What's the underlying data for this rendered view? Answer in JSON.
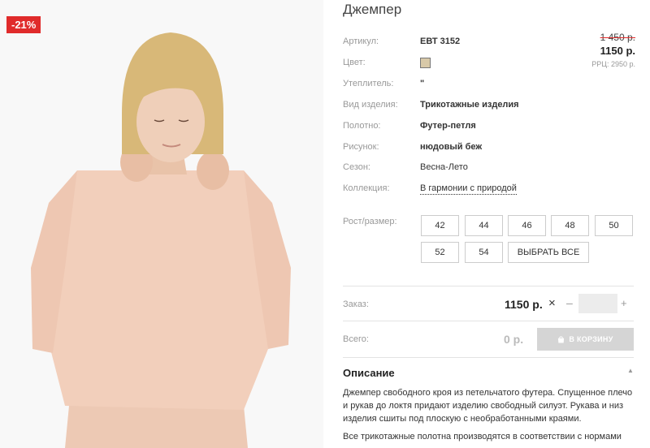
{
  "badge": "-21%",
  "product": {
    "title": "Джемпер",
    "old_price": "1 450 р.",
    "price": "1150 р.",
    "rrp": "РРЦ: 2950 р."
  },
  "attributes": {
    "article_label": "Артикул:",
    "article_value": "ЕВТ 3152",
    "color_label": "Цвет:",
    "color_hex": "#d8c9a8",
    "insulation_label": "Утеплитель:",
    "insulation_value": "\"",
    "type_label": "Вид изделия:",
    "type_value": "Трикотажные изделия",
    "fabric_label": "Полотно:",
    "fabric_value": "Футер-петля",
    "pattern_label": "Рисунок:",
    "pattern_value": "нюдовый беж",
    "season_label": "Сезон:",
    "season_value": "Весна-Лето",
    "collection_label": "Коллекция:",
    "collection_value": "В гармонии с природой"
  },
  "sizes": {
    "label": "Рост/размер:",
    "options": [
      "42",
      "44",
      "46",
      "48",
      "50",
      "52",
      "54"
    ],
    "select_all": "ВЫБРАТЬ ВСЕ"
  },
  "order": {
    "label": "Заказ:",
    "price": "1150 р.",
    "times": "×",
    "minus": "–",
    "plus": "+",
    "qty_value": ""
  },
  "total": {
    "label": "Всего:",
    "value": "0 р.",
    "cart_button": "В КОРЗИНУ"
  },
  "description": {
    "heading": "Описание",
    "text": "Джемпер свободного кроя из петельчатого футера. Спущенное плечо и рукав до локтя придают изделию свободный силуэт. Рукава и низ изделия сшиты под плоскую с необработанными краями.",
    "text2": "Все трикотажные полотна производятся в соответствии с нормами"
  },
  "colors": {
    "badge_red": "#e02b2b",
    "cart_button_bg": "#d5d5d5"
  }
}
